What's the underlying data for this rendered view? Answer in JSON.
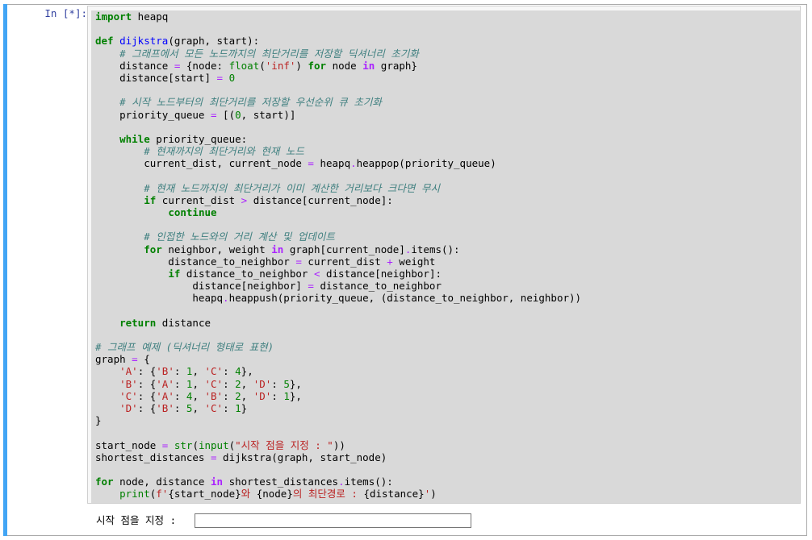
{
  "cell": {
    "prompt": "In [*]:",
    "code_lines": [
      [
        {
          "t": "k",
          "v": "import"
        },
        {
          "t": "",
          "v": " heapq"
        }
      ],
      [],
      [
        {
          "t": "k",
          "v": "def"
        },
        {
          "t": "",
          "v": " "
        },
        {
          "t": "fn",
          "v": "dijkstra"
        },
        {
          "t": "",
          "v": "(graph, start):"
        }
      ],
      [
        {
          "t": "",
          "v": "    "
        },
        {
          "t": "c",
          "v": "# 그래프에서 모든 노드까지의 최단거리를 저장할 딕셔너리 초기화"
        }
      ],
      [
        {
          "t": "",
          "v": "    distance "
        },
        {
          "t": "o",
          "v": "="
        },
        {
          "t": "",
          "v": " {node: "
        },
        {
          "t": "b",
          "v": "float"
        },
        {
          "t": "",
          "v": "("
        },
        {
          "t": "s",
          "v": "'inf'"
        },
        {
          "t": "",
          "v": ") "
        },
        {
          "t": "k",
          "v": "for"
        },
        {
          "t": "",
          "v": " node "
        },
        {
          "t": "ow",
          "v": "in"
        },
        {
          "t": "",
          "v": " graph}"
        }
      ],
      [
        {
          "t": "",
          "v": "    distance[start] "
        },
        {
          "t": "o",
          "v": "="
        },
        {
          "t": "",
          "v": " "
        },
        {
          "t": "n",
          "v": "0"
        }
      ],
      [],
      [
        {
          "t": "",
          "v": "    "
        },
        {
          "t": "c",
          "v": "# 시작 노드부터의 최단거리를 저장할 우선순위 큐 초기화"
        }
      ],
      [
        {
          "t": "",
          "v": "    priority_queue "
        },
        {
          "t": "o",
          "v": "="
        },
        {
          "t": "",
          "v": " [("
        },
        {
          "t": "n",
          "v": "0"
        },
        {
          "t": "",
          "v": ", start)]"
        }
      ],
      [],
      [
        {
          "t": "",
          "v": "    "
        },
        {
          "t": "k",
          "v": "while"
        },
        {
          "t": "",
          "v": " priority_queue:"
        }
      ],
      [
        {
          "t": "",
          "v": "        "
        },
        {
          "t": "c",
          "v": "# 현재까지의 최단거리와 현재 노드"
        }
      ],
      [
        {
          "t": "",
          "v": "        current_dist, current_node "
        },
        {
          "t": "o",
          "v": "="
        },
        {
          "t": "",
          "v": " heapq"
        },
        {
          "t": "o",
          "v": "."
        },
        {
          "t": "",
          "v": "heappop(priority_queue)"
        }
      ],
      [],
      [
        {
          "t": "",
          "v": "        "
        },
        {
          "t": "c",
          "v": "# 현재 노드까지의 최단거리가 이미 계산한 거리보다 크다면 무시"
        }
      ],
      [
        {
          "t": "",
          "v": "        "
        },
        {
          "t": "k",
          "v": "if"
        },
        {
          "t": "",
          "v": " current_dist "
        },
        {
          "t": "o",
          "v": ">"
        },
        {
          "t": "",
          "v": " distance[current_node]:"
        }
      ],
      [
        {
          "t": "",
          "v": "            "
        },
        {
          "t": "k",
          "v": "continue"
        }
      ],
      [],
      [
        {
          "t": "",
          "v": "        "
        },
        {
          "t": "c",
          "v": "# 인접한 노드와의 거리 계산 및 업데이트"
        }
      ],
      [
        {
          "t": "",
          "v": "        "
        },
        {
          "t": "k",
          "v": "for"
        },
        {
          "t": "",
          "v": " neighbor, weight "
        },
        {
          "t": "ow",
          "v": "in"
        },
        {
          "t": "",
          "v": " graph[current_node]"
        },
        {
          "t": "o",
          "v": "."
        },
        {
          "t": "",
          "v": "items():"
        }
      ],
      [
        {
          "t": "",
          "v": "            distance_to_neighbor "
        },
        {
          "t": "o",
          "v": "="
        },
        {
          "t": "",
          "v": " current_dist "
        },
        {
          "t": "o",
          "v": "+"
        },
        {
          "t": "",
          "v": " weight"
        }
      ],
      [
        {
          "t": "",
          "v": "            "
        },
        {
          "t": "k",
          "v": "if"
        },
        {
          "t": "",
          "v": " distance_to_neighbor "
        },
        {
          "t": "o",
          "v": "<"
        },
        {
          "t": "",
          "v": " distance[neighbor]:"
        }
      ],
      [
        {
          "t": "",
          "v": "                distance[neighbor] "
        },
        {
          "t": "o",
          "v": "="
        },
        {
          "t": "",
          "v": " distance_to_neighbor"
        }
      ],
      [
        {
          "t": "",
          "v": "                heapq"
        },
        {
          "t": "o",
          "v": "."
        },
        {
          "t": "",
          "v": "heappush(priority_queue, (distance_to_neighbor, neighbor))"
        }
      ],
      [],
      [
        {
          "t": "",
          "v": "    "
        },
        {
          "t": "k",
          "v": "return"
        },
        {
          "t": "",
          "v": " distance"
        }
      ],
      [],
      [
        {
          "t": "c",
          "v": "# 그래프 예제 (딕셔너리 형태로 표현)"
        }
      ],
      [
        {
          "t": "",
          "v": "graph "
        },
        {
          "t": "o",
          "v": "="
        },
        {
          "t": "",
          "v": " {"
        }
      ],
      [
        {
          "t": "",
          "v": "    "
        },
        {
          "t": "s",
          "v": "'A'"
        },
        {
          "t": "",
          "v": ": {"
        },
        {
          "t": "s",
          "v": "'B'"
        },
        {
          "t": "",
          "v": ": "
        },
        {
          "t": "n",
          "v": "1"
        },
        {
          "t": "",
          "v": ", "
        },
        {
          "t": "s",
          "v": "'C'"
        },
        {
          "t": "",
          "v": ": "
        },
        {
          "t": "n",
          "v": "4"
        },
        {
          "t": "",
          "v": "},"
        }
      ],
      [
        {
          "t": "",
          "v": "    "
        },
        {
          "t": "s",
          "v": "'B'"
        },
        {
          "t": "",
          "v": ": {"
        },
        {
          "t": "s",
          "v": "'A'"
        },
        {
          "t": "",
          "v": ": "
        },
        {
          "t": "n",
          "v": "1"
        },
        {
          "t": "",
          "v": ", "
        },
        {
          "t": "s",
          "v": "'C'"
        },
        {
          "t": "",
          "v": ": "
        },
        {
          "t": "n",
          "v": "2"
        },
        {
          "t": "",
          "v": ", "
        },
        {
          "t": "s",
          "v": "'D'"
        },
        {
          "t": "",
          "v": ": "
        },
        {
          "t": "n",
          "v": "5"
        },
        {
          "t": "",
          "v": "},"
        }
      ],
      [
        {
          "t": "",
          "v": "    "
        },
        {
          "t": "s",
          "v": "'C'"
        },
        {
          "t": "",
          "v": ": {"
        },
        {
          "t": "s",
          "v": "'A'"
        },
        {
          "t": "",
          "v": ": "
        },
        {
          "t": "n",
          "v": "4"
        },
        {
          "t": "",
          "v": ", "
        },
        {
          "t": "s",
          "v": "'B'"
        },
        {
          "t": "",
          "v": ": "
        },
        {
          "t": "n",
          "v": "2"
        },
        {
          "t": "",
          "v": ", "
        },
        {
          "t": "s",
          "v": "'D'"
        },
        {
          "t": "",
          "v": ": "
        },
        {
          "t": "n",
          "v": "1"
        },
        {
          "t": "",
          "v": "},"
        }
      ],
      [
        {
          "t": "",
          "v": "    "
        },
        {
          "t": "s",
          "v": "'D'"
        },
        {
          "t": "",
          "v": ": {"
        },
        {
          "t": "s",
          "v": "'B'"
        },
        {
          "t": "",
          "v": ": "
        },
        {
          "t": "n",
          "v": "5"
        },
        {
          "t": "",
          "v": ", "
        },
        {
          "t": "s",
          "v": "'C'"
        },
        {
          "t": "",
          "v": ": "
        },
        {
          "t": "n",
          "v": "1"
        },
        {
          "t": "",
          "v": "}"
        }
      ],
      [
        {
          "t": "",
          "v": "}"
        }
      ],
      [],
      [
        {
          "t": "",
          "v": "start_node "
        },
        {
          "t": "o",
          "v": "="
        },
        {
          "t": "",
          "v": " "
        },
        {
          "t": "b",
          "v": "str"
        },
        {
          "t": "",
          "v": "("
        },
        {
          "t": "b",
          "v": "input"
        },
        {
          "t": "",
          "v": "("
        },
        {
          "t": "s",
          "v": "\"시작 점을 지정 : \""
        },
        {
          "t": "",
          "v": "))"
        }
      ],
      [
        {
          "t": "",
          "v": "shortest_distances "
        },
        {
          "t": "o",
          "v": "="
        },
        {
          "t": "",
          "v": " dijkstra(graph, start_node)"
        }
      ],
      [],
      [
        {
          "t": "k",
          "v": "for"
        },
        {
          "t": "",
          "v": " node, distance "
        },
        {
          "t": "ow",
          "v": "in"
        },
        {
          "t": "",
          "v": " shortest_distances"
        },
        {
          "t": "o",
          "v": "."
        },
        {
          "t": "",
          "v": "items():"
        }
      ],
      [
        {
          "t": "",
          "v": "    "
        },
        {
          "t": "b",
          "v": "print"
        },
        {
          "t": "",
          "v": "("
        },
        {
          "t": "s",
          "v": "f'"
        },
        {
          "t": "",
          "v": "{start_node}"
        },
        {
          "t": "s",
          "v": "와 "
        },
        {
          "t": "",
          "v": "{node}"
        },
        {
          "t": "s",
          "v": "의 최단경로 : "
        },
        {
          "t": "",
          "v": "{distance}"
        },
        {
          "t": "s",
          "v": "'"
        },
        {
          "t": "",
          "v": ")"
        }
      ]
    ]
  },
  "stdin": {
    "prompt": "시작 점을 지정 :",
    "value": ""
  },
  "colors": {
    "cell_bar": "#42a5f5",
    "keyword": "#008000",
    "operator": "#aa22ff",
    "string": "#ba2121",
    "comment": "#408080",
    "function": "#0000ff"
  }
}
